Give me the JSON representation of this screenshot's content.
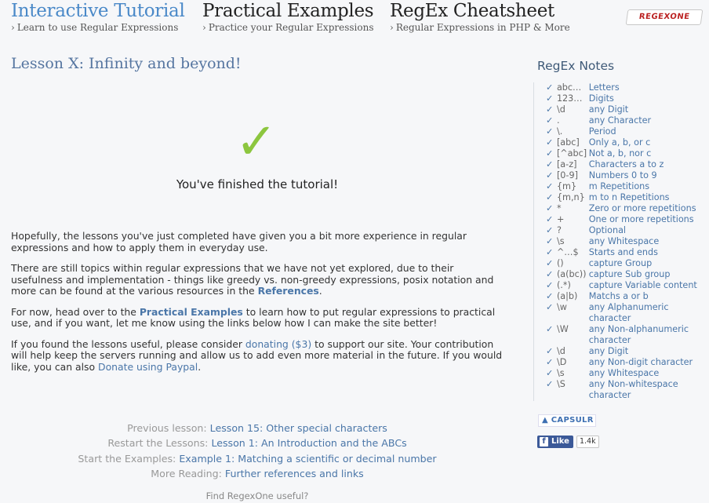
{
  "nav": [
    {
      "title": "Interactive Tutorial",
      "sub": "Learn to use Regular Expressions",
      "active": true
    },
    {
      "title": "Practical Examples",
      "sub": "Practice your Regular Expressions",
      "active": false
    },
    {
      "title": "RegEx Cheatsheet",
      "sub": "Regular Expressions in PHP & More",
      "active": false
    }
  ],
  "logo": "REGEXONE",
  "lesson": {
    "title": "Lesson X: Infinity and beyond!",
    "check_glyph": "✓",
    "finished": "You've finished the tutorial!",
    "p1": "Hopefully, the lessons you've just completed have given you a bit more experience in regular expressions and how to apply them in everyday use.",
    "p2_pre": "There are still topics within regular expressions that we have not yet explored, due to their usefulness and implementation - things like greedy vs. non-greedy expressions, posix notation and more can be found at the various resources in the ",
    "p2_link": "References",
    "p2_post": ".",
    "p3_pre": "For now, head over to the ",
    "p3_link": "Practical Examples",
    "p3_post": " to learn how to put regular expressions to practical use, and if you want, let me know using the links below how I can make the site better!",
    "p4_pre": "If you found the lessons useful, please consider ",
    "p4_link1": "donating ($3)",
    "p4_mid": " to support our site. Your contribution will help keep the servers running and allow us to add even more material in the future. If you would like, you can also ",
    "p4_link2": "Donate using Paypal",
    "p4_post": "."
  },
  "links": [
    {
      "label": "Previous lesson:",
      "link": "Lesson 15: Other special characters"
    },
    {
      "label": "Restart the Lessons:",
      "link": "Lesson 1: An Introduction and the ABCs"
    },
    {
      "label": "Start the Examples:",
      "link": "Example 1: Matching a scientific or decimal number"
    },
    {
      "label": "More Reading:",
      "link": "Further references and links"
    }
  ],
  "find_text": "Find RegexOne useful?",
  "notes_title": "RegEx Notes",
  "notes": [
    {
      "pat": "abc…",
      "desc": "Letters"
    },
    {
      "pat": "123…",
      "desc": "Digits"
    },
    {
      "pat": "\\d",
      "desc": "any Digit"
    },
    {
      "pat": ".",
      "desc": "any Character"
    },
    {
      "pat": "\\.",
      "desc": "Period"
    },
    {
      "pat": "[abc]",
      "desc": "Only a, b, or c"
    },
    {
      "pat": "[^abc]",
      "desc": "Not a, b, nor c"
    },
    {
      "pat": "[a-z]",
      "desc": "Characters a to z"
    },
    {
      "pat": "[0-9]",
      "desc": "Numbers 0 to 9"
    },
    {
      "pat": "{m}",
      "desc": "m Repetitions"
    },
    {
      "pat": "{m,n}",
      "desc": "m to n Repetitions"
    },
    {
      "pat": "*",
      "desc": "Zero or more repetitions"
    },
    {
      "pat": "+",
      "desc": "One or more repetitions"
    },
    {
      "pat": "?",
      "desc": "Optional"
    },
    {
      "pat": "\\s",
      "desc": "any Whitespace"
    },
    {
      "pat": "^…$",
      "desc": "Starts and ends"
    },
    {
      "pat": "()",
      "desc": "capture Group"
    },
    {
      "pat": "(a(bc))",
      "desc": "capture Sub group"
    },
    {
      "pat": "(.*)",
      "desc": "capture Variable content"
    },
    {
      "pat": "(a|b)",
      "desc": "Matchs a or b"
    },
    {
      "pat": "\\w",
      "desc": "any Alphanumeric character"
    },
    {
      "pat": "\\W",
      "desc": "any Non-alphanumeric character"
    },
    {
      "pat": "\\d",
      "desc": "any Digit"
    },
    {
      "pat": "\\D",
      "desc": "any Non-digit character"
    },
    {
      "pat": "\\s",
      "desc": "any Whitespace"
    },
    {
      "pat": "\\S",
      "desc": "any Non-whitespace character"
    }
  ],
  "capsulr": "CAPSULR",
  "fb": {
    "like": "Like",
    "count": "1.4k"
  },
  "colors": {
    "accent": "#4a89c8",
    "link": "#4a76a8",
    "check": "#8cc63f",
    "facebook": "#3b5998"
  }
}
